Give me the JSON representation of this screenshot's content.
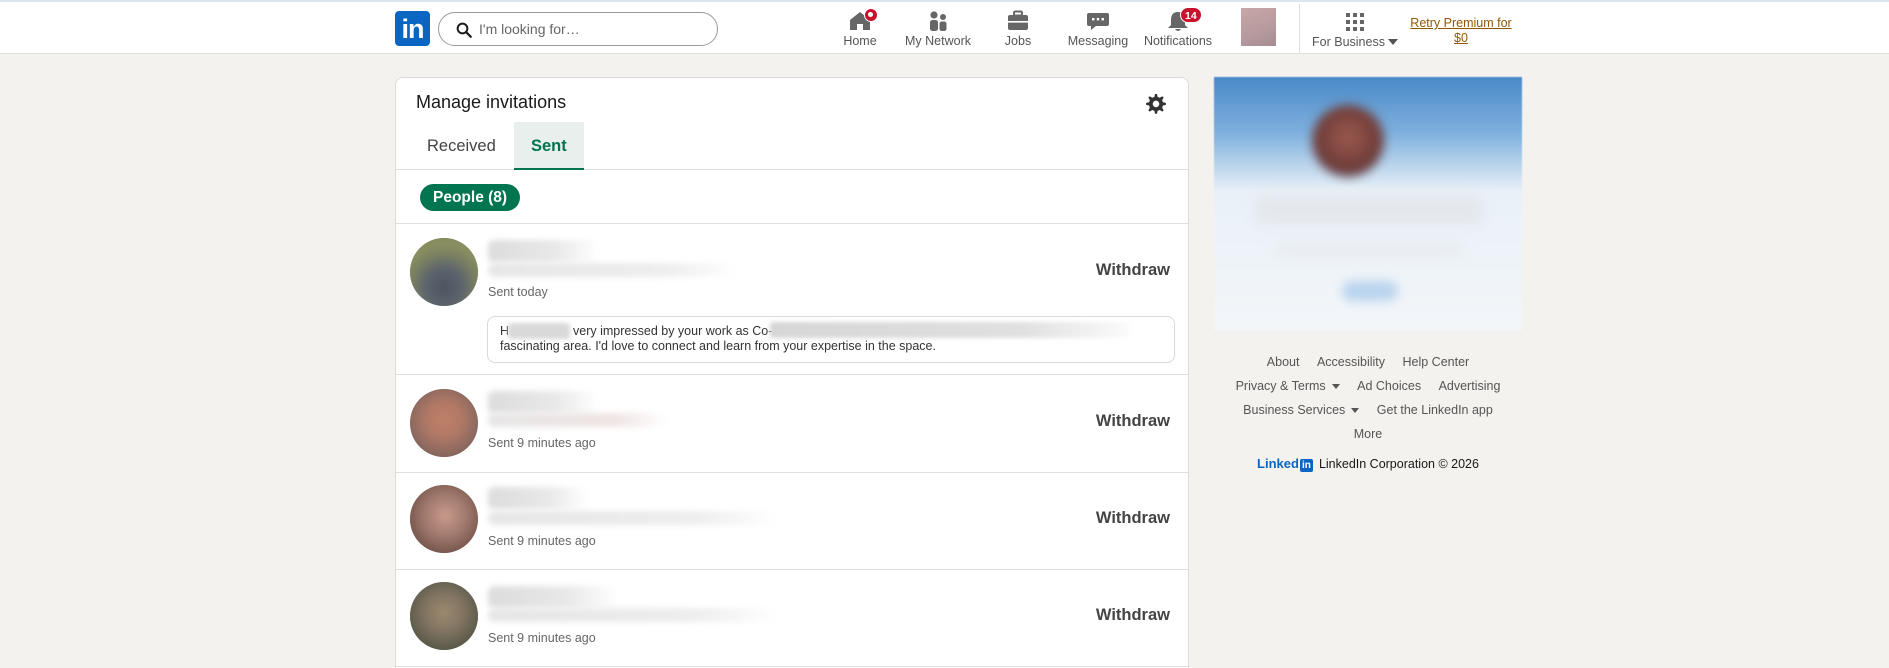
{
  "header": {
    "logo_text": "in",
    "search_placeholder": "I'm looking for…",
    "nav": [
      {
        "label": "Home",
        "icon": "home-icon",
        "badge": ""
      },
      {
        "label": "My Network",
        "icon": "network-icon",
        "badge": ""
      },
      {
        "label": "Jobs",
        "icon": "briefcase-icon",
        "badge": ""
      },
      {
        "label": "Messaging",
        "icon": "messaging-icon",
        "badge": ""
      },
      {
        "label": "Notifications",
        "icon": "bell-icon",
        "badge": "14"
      }
    ],
    "business_label": "For Business",
    "premium_label": "Retry Premium for $0"
  },
  "main": {
    "title": "Manage invitations",
    "tabs": [
      {
        "label": "Received",
        "active": false
      },
      {
        "label": "Sent",
        "active": true
      }
    ],
    "filter_label": "People (8)",
    "invitations": [
      {
        "sent": "Sent today",
        "action": "Withdraw",
        "message_line1_start": "H",
        "message_line1_mid": "very impressed by your work as Co-",
        "message_line2": "fascinating area. I'd love to connect and learn from your expertise in the space."
      },
      {
        "sent": "Sent 9 minutes ago",
        "action": "Withdraw"
      },
      {
        "sent": "Sent 9 minutes ago",
        "action": "Withdraw"
      },
      {
        "sent": "Sent 9 minutes ago",
        "action": "Withdraw"
      }
    ]
  },
  "footer": {
    "links_row1": [
      "About",
      "Accessibility",
      "Help Center"
    ],
    "links_row2": [
      "Privacy & Terms",
      "Ad Choices",
      "Advertising"
    ],
    "links_row3": [
      "Business Services",
      "Get the LinkedIn app"
    ],
    "links_row4": [
      "More"
    ],
    "brand_word": "Linked",
    "brand_box": "in",
    "copyright": "LinkedIn Corporation © 2026"
  },
  "colors": {
    "brand_blue": "#0a66c2",
    "accent_green": "#01754f",
    "badge_red": "#cb112d",
    "premium_gold": "#915907"
  }
}
